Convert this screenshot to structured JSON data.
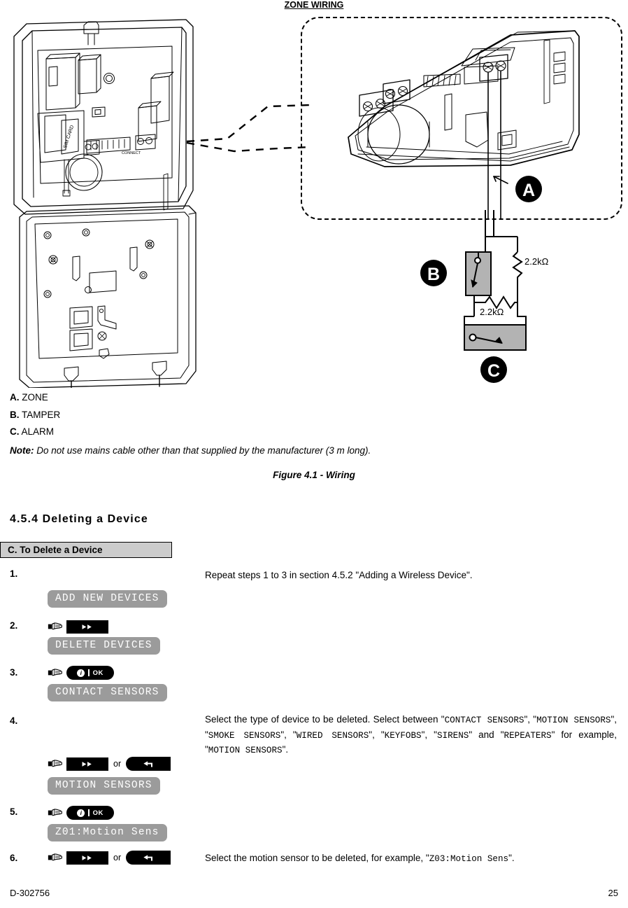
{
  "figure": {
    "title": "ZONE WIRING",
    "caption": "Figure 4.1 - Wiring",
    "legend": [
      {
        "letter": "A.",
        "label": "ZONE"
      },
      {
        "letter": "B.",
        "label": "TAMPER"
      },
      {
        "letter": "C.",
        "label": "ALARM"
      }
    ],
    "note_label": "Note:",
    "note_text": "Do not use mains cable other than that supplied by the manufacturer (3 m long).",
    "callout_markers": [
      "A",
      "B",
      "C"
    ],
    "resistors": [
      "2.2kΩ",
      "2.2kΩ"
    ],
    "sim_card_label": "SIM CARD"
  },
  "section": {
    "number_title": "4.5.4 Deleting a Device",
    "table_header": "C. To Delete a Device"
  },
  "icons": {
    "hand": "pointing-hand-icon",
    "fast_forward": "▶▶",
    "info": "i",
    "ok": "OK",
    "back_arrow": "back-arrow-icon"
  },
  "labels": {
    "or": "or"
  },
  "steps": [
    {
      "number": "1.",
      "keys": [],
      "display": "ADD NEW DEVICES",
      "text_runs": [
        {
          "t": "Repeat steps 1 to 3 in section 4.5.2 \"Adding a Wireless Device\".",
          "mono": false
        }
      ]
    },
    {
      "number": "2.",
      "keys": [
        "fast_forward"
      ],
      "display": "DELETE DEVICES",
      "text_runs": []
    },
    {
      "number": "3.",
      "keys": [
        "ok"
      ],
      "display": "CONTACT SENSORS",
      "text_runs": []
    },
    {
      "number": "4.",
      "keys": [
        "fast_forward",
        "or",
        "back"
      ],
      "display": "MOTION SENSORS",
      "text_runs": [
        {
          "t": "Select the type of device to be deleted. Select between \"",
          "mono": false
        },
        {
          "t": "CONTACT SENSORS",
          "mono": true
        },
        {
          "t": "\", \"",
          "mono": false
        },
        {
          "t": "MOTION SENSORS",
          "mono": true
        },
        {
          "t": "\", \"",
          "mono": false
        },
        {
          "t": "SMOKE SENSORS",
          "mono": true
        },
        {
          "t": "\", \"",
          "mono": false
        },
        {
          "t": "WIRED SENSORS",
          "mono": true
        },
        {
          "t": "\", \"",
          "mono": false
        },
        {
          "t": "KEYFOBS",
          "mono": true
        },
        {
          "t": "\", \"",
          "mono": false
        },
        {
          "t": "SIRENS",
          "mono": true
        },
        {
          "t": "\" and \"",
          "mono": false
        },
        {
          "t": "REPEATERS",
          "mono": true
        },
        {
          "t": "\" for example, \"",
          "mono": false
        },
        {
          "t": "MOTION SENSORS",
          "mono": true
        },
        {
          "t": "\".",
          "mono": false
        }
      ]
    },
    {
      "number": "5.",
      "keys": [
        "ok"
      ],
      "display": "Z01:Motion Sens",
      "text_runs": []
    },
    {
      "number": "6.",
      "keys": [
        "fast_forward",
        "or",
        "back"
      ],
      "display": null,
      "text_runs": [
        {
          "t": "Select the motion sensor to be deleted, for example, \"",
          "mono": false
        },
        {
          "t": "Z03:Motion Sens",
          "mono": true
        },
        {
          "t": "\".",
          "mono": false
        }
      ]
    }
  ],
  "footer": {
    "doc_id": "D-302756",
    "page_number": "25"
  }
}
